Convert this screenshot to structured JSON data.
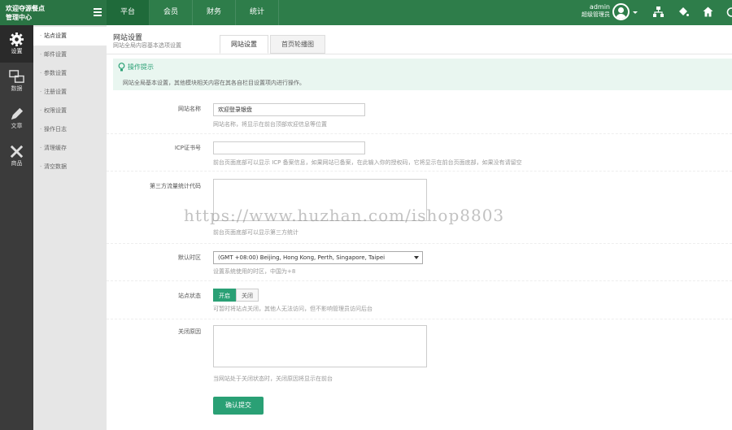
{
  "brand": {
    "line1": "欢迎夺源餐点",
    "line2": "管理中心"
  },
  "nav": {
    "items": [
      "平台",
      "会员",
      "财务",
      "统计"
    ],
    "active": 0
  },
  "user": {
    "name": "admin",
    "role": "超级管理员"
  },
  "top_icons": [
    "sitemap-icon",
    "paint-icon",
    "home-icon",
    "power-icon"
  ],
  "iconbar": {
    "items": [
      {
        "label": "设置",
        "icon": "gear-icon"
      },
      {
        "label": "数据",
        "icon": "chat-icon"
      },
      {
        "label": "文章",
        "icon": "pen-icon"
      },
      {
        "label": "商品",
        "icon": "tools-icon"
      }
    ]
  },
  "submenu": {
    "items": [
      "站点设置",
      "邮件设置",
      "参数设置",
      "注册设置",
      "权限设置",
      "操作日志",
      "清理缓存",
      "清空数据"
    ],
    "active": 0
  },
  "page": {
    "title": "网站设置",
    "subtitle": "网站全局内容基本选项设置"
  },
  "tabs": [
    "网站设置",
    "首页轮播图"
  ],
  "tips": {
    "title": "操作提示",
    "text": "网站全局基本设置，其他模块相关内容在其各自栏目设置项内进行操作。"
  },
  "form": {
    "site_name": {
      "label": "网站名称",
      "value": "欢迎登录银盘",
      "hint": "网站名称，将显示在前台顶部欢迎信息等位置"
    },
    "icp": {
      "label": "ICP证书号",
      "value": "",
      "hint": "前台页面底部可以显示 ICP 备案信息，如果网站已备案，在此输入你的授权码，它将显示在前台页面底部，如果没有请留空"
    },
    "stats_code": {
      "label": "第三方流量统计代码",
      "value": "",
      "hint": "前台页面底部可以显示第三方统计"
    },
    "timezone": {
      "label": "默认时区",
      "value": "(GMT +08:00) Beijing, Hong Kong, Perth, Singapore, Taipei",
      "hint": "设置系统使用的时区，中国为+8"
    },
    "site_status": {
      "label": "站点状态",
      "on": "开启",
      "off": "关闭",
      "selected": "on",
      "hint": "可暂时将站点关闭，其他人无法访问，但不影响管理员访问后台"
    },
    "close_reason": {
      "label": "关闭原因",
      "value": "",
      "hint": "当网站处于关闭状态时，关闭原因将显示在前台"
    },
    "submit": "确认提交"
  },
  "watermark": "https://www.huzhan.com/ishop8803",
  "colors": {
    "topbar": "#2e7d4a",
    "accent": "#2aa075",
    "sidebar": "#3b3b3b"
  }
}
